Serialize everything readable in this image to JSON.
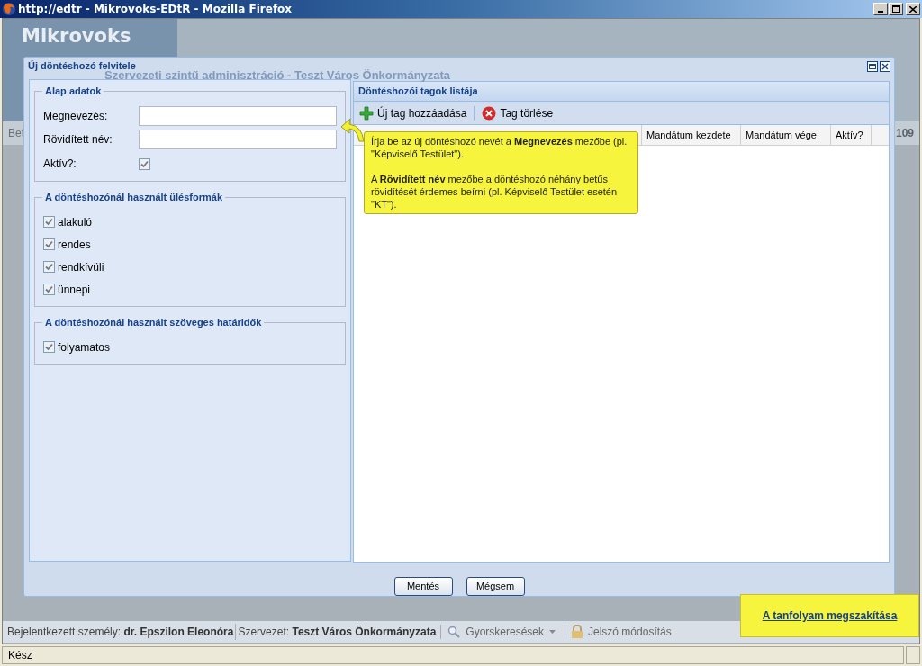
{
  "browser": {
    "title": "http://edtr - Mikrovoks-EDtR - Mozilla Firefox",
    "status": "Kész"
  },
  "app": {
    "logo": "Mikrovoks",
    "background_title": "Szervezeti szintű adminisztráció - Teszt Város Önkormányzata",
    "left_fragment": "Bet",
    "right_fragment": "109"
  },
  "dialog": {
    "title": "Új döntéshozó felvitele",
    "basic": {
      "legend": "Alap adatok",
      "fields": [
        {
          "label": "Megnevezés:"
        },
        {
          "label": "Rövidített név:"
        }
      ],
      "active": {
        "label": "Aktív?:",
        "checked": true
      }
    },
    "groups": [
      {
        "legend": "A döntéshozónál használt ülésformák",
        "options": [
          {
            "label": "alakuló",
            "checked": true
          },
          {
            "label": "rendes",
            "checked": true
          },
          {
            "label": "rendkívüli",
            "checked": true
          },
          {
            "label": "ünnepi",
            "checked": true
          }
        ]
      },
      {
        "legend": "A döntéshozónál használt szöveges határidők",
        "options": [
          {
            "label": "folyamatos",
            "checked": true
          }
        ]
      }
    ],
    "members": {
      "title": "Döntéshozói tagok listája",
      "toolbar": [
        {
          "kind": "add",
          "label": "Új tag hozzáadása"
        },
        {
          "kind": "delete",
          "label": "Tag törlése"
        }
      ],
      "columns": [
        "Mandátum kezdete",
        "Mandátum vége",
        "Aktív?"
      ]
    },
    "tooltip": {
      "paragraphs": [
        "Írja be az új döntéshozó nevét a **Megnevezés** mezőbe (pl. \"Képviselő Testület\").",
        "A **Rövidített név** mezőbe a döntéshozó néhány betűs rövidítését érdemes beírni (pl. Képviselő Testület esetén \"KT\")."
      ]
    },
    "buttons": [
      "Mentés",
      "Mégsem"
    ]
  },
  "footer": {
    "items": [
      {
        "label": "Bejelentkezett személy:",
        "value": "dr. Epszilon Eleonóra"
      },
      {
        "label": "Szervezet:",
        "value": "Teszt Város Önkormányzata"
      }
    ],
    "quick_search": "Gyorskeresések",
    "password": "Jelszó módosítás"
  },
  "course_link": "A tanfolyam megszakítása"
}
